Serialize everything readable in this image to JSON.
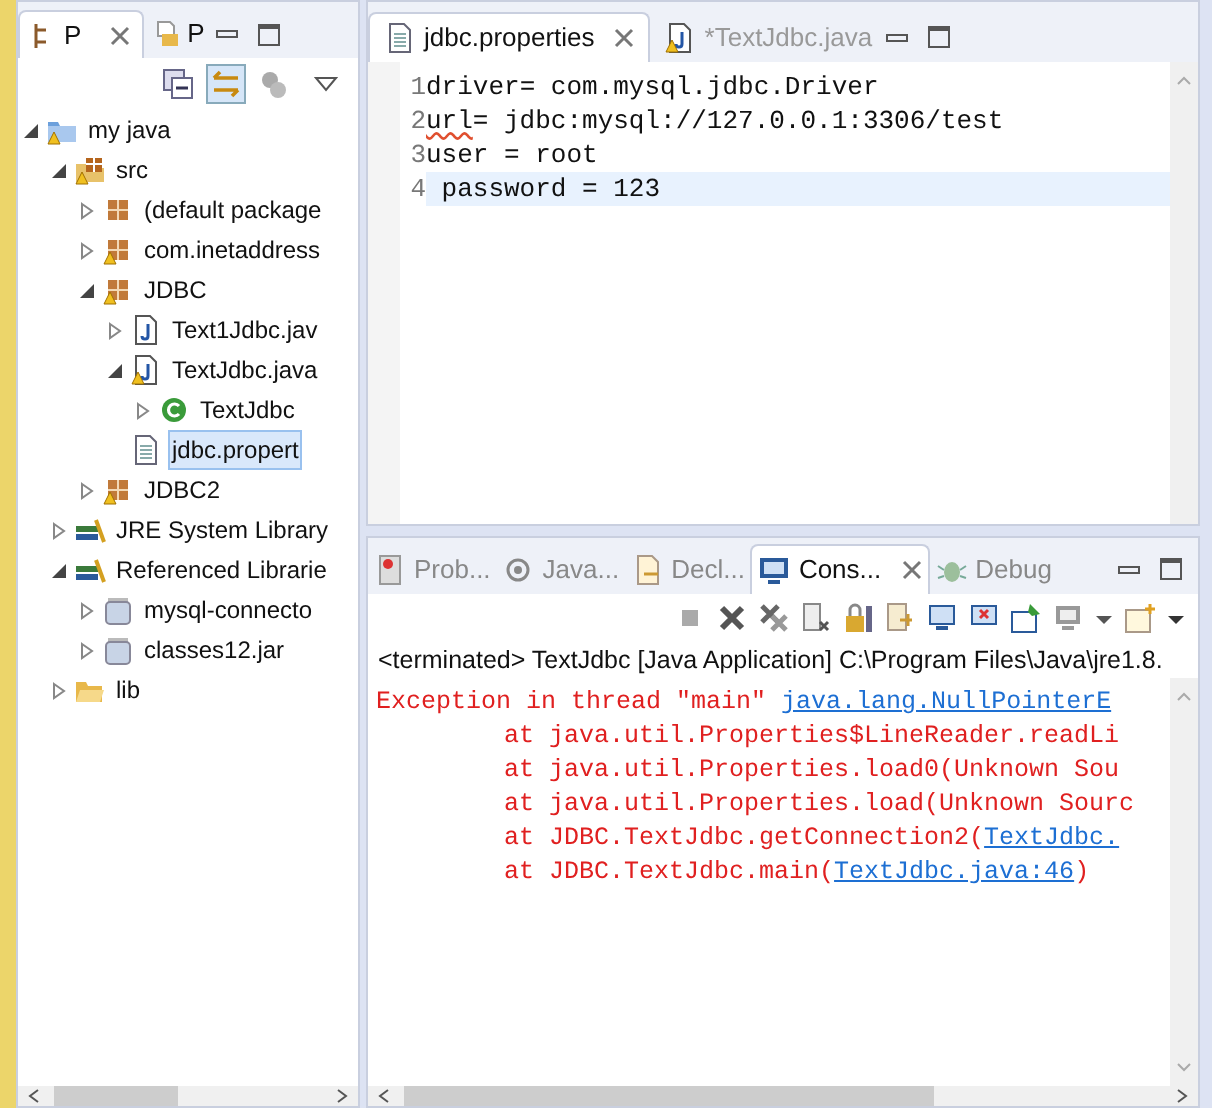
{
  "explorer": {
    "tabs": [
      {
        "label": "P",
        "selected": true
      },
      {
        "label": "P",
        "selected": false
      }
    ],
    "tree": [
      {
        "label": "my java",
        "kind": "project",
        "warning": true,
        "expanded": true,
        "selected": false,
        "children": [
          {
            "label": "src",
            "kind": "source-folder",
            "warning": true,
            "expanded": true,
            "selected": false,
            "children": [
              {
                "label": "(default package",
                "kind": "package",
                "warning": false,
                "expanded": false,
                "selected": false
              },
              {
                "label": "com.inetaddress",
                "kind": "package",
                "warning": true,
                "expanded": false,
                "selected": false
              },
              {
                "label": "JDBC",
                "kind": "package",
                "warning": true,
                "expanded": true,
                "selected": false,
                "children": [
                  {
                    "label": "Text1Jdbc.jav",
                    "kind": "java-file",
                    "warning": false,
                    "expanded": false,
                    "selected": false
                  },
                  {
                    "label": "TextJdbc.java",
                    "kind": "java-file",
                    "warning": true,
                    "expanded": true,
                    "selected": false,
                    "children": [
                      {
                        "label": "TextJdbc",
                        "kind": "class",
                        "warning": false,
                        "expanded": false,
                        "selected": false
                      }
                    ]
                  },
                  {
                    "label": "jdbc.propert",
                    "kind": "properties-file",
                    "warning": false,
                    "selected": true
                  }
                ]
              },
              {
                "label": "JDBC2",
                "kind": "package",
                "warning": true,
                "expanded": false,
                "selected": false
              }
            ]
          },
          {
            "label": "JRE System Library",
            "kind": "library",
            "warning": false,
            "expanded": false,
            "selected": false
          },
          {
            "label": "Referenced Librarie",
            "kind": "library",
            "warning": false,
            "expanded": true,
            "selected": false,
            "children": [
              {
                "label": "mysql-connecto",
                "kind": "jar",
                "warning": false,
                "expanded": false,
                "selected": false
              },
              {
                "label": "classes12.jar",
                "kind": "jar",
                "warning": false,
                "expanded": false,
                "selected": false
              }
            ]
          },
          {
            "label": "lib",
            "kind": "folder",
            "warning": false,
            "expanded": false,
            "selected": false
          }
        ]
      }
    ]
  },
  "editor": {
    "tabs": [
      {
        "label": "jdbc.properties",
        "kind": "properties-file",
        "selected": true
      },
      {
        "label": "*TextJdbc.java",
        "kind": "java-file",
        "selected": false
      }
    ],
    "lines": [
      {
        "number": "1",
        "key": "driver",
        "rest": "= com.mysql.jdbc.Driver",
        "spell_warning": false,
        "current": false
      },
      {
        "number": "2",
        "key": "url",
        "rest": "= jdbc:mysql://127.0.0.1:3306/test",
        "spell_warning": true,
        "current": false
      },
      {
        "number": "3",
        "key": "user",
        "rest": " = root",
        "spell_warning": false,
        "current": false
      },
      {
        "number": "4",
        "key": " password",
        "rest": " = 123",
        "spell_warning": false,
        "current": true
      }
    ]
  },
  "console": {
    "tabs": [
      {
        "label": "Prob...",
        "kind": "problems",
        "selected": false
      },
      {
        "label": "Java...",
        "kind": "javadoc",
        "selected": false
      },
      {
        "label": "Decl...",
        "kind": "declaration",
        "selected": false
      },
      {
        "label": "Cons...",
        "kind": "console",
        "selected": true
      },
      {
        "label": "Debug",
        "kind": "debug",
        "selected": false
      }
    ],
    "header": "<terminated> TextJdbc [Java Application] C:\\Program Files\\Java\\jre1.8.",
    "lines": [
      {
        "indented": false,
        "text": "Exception in thread \"main\" ",
        "link": "java.lang.NullPointerE"
      },
      {
        "indented": true,
        "text": "at java.util.Properties$LineReader.readLi"
      },
      {
        "indented": true,
        "text": "at java.util.Properties.load0(Unknown Sou"
      },
      {
        "indented": true,
        "text": "at java.util.Properties.load(Unknown Sourc"
      },
      {
        "indented": true,
        "text": "at JDBC.TextJdbc.getConnection2(",
        "link": "TextJdbc."
      },
      {
        "indented": true,
        "text": "at JDBC.TextJdbc.main(",
        "link": "TextJdbc.java:46",
        "after": ")"
      }
    ]
  }
}
